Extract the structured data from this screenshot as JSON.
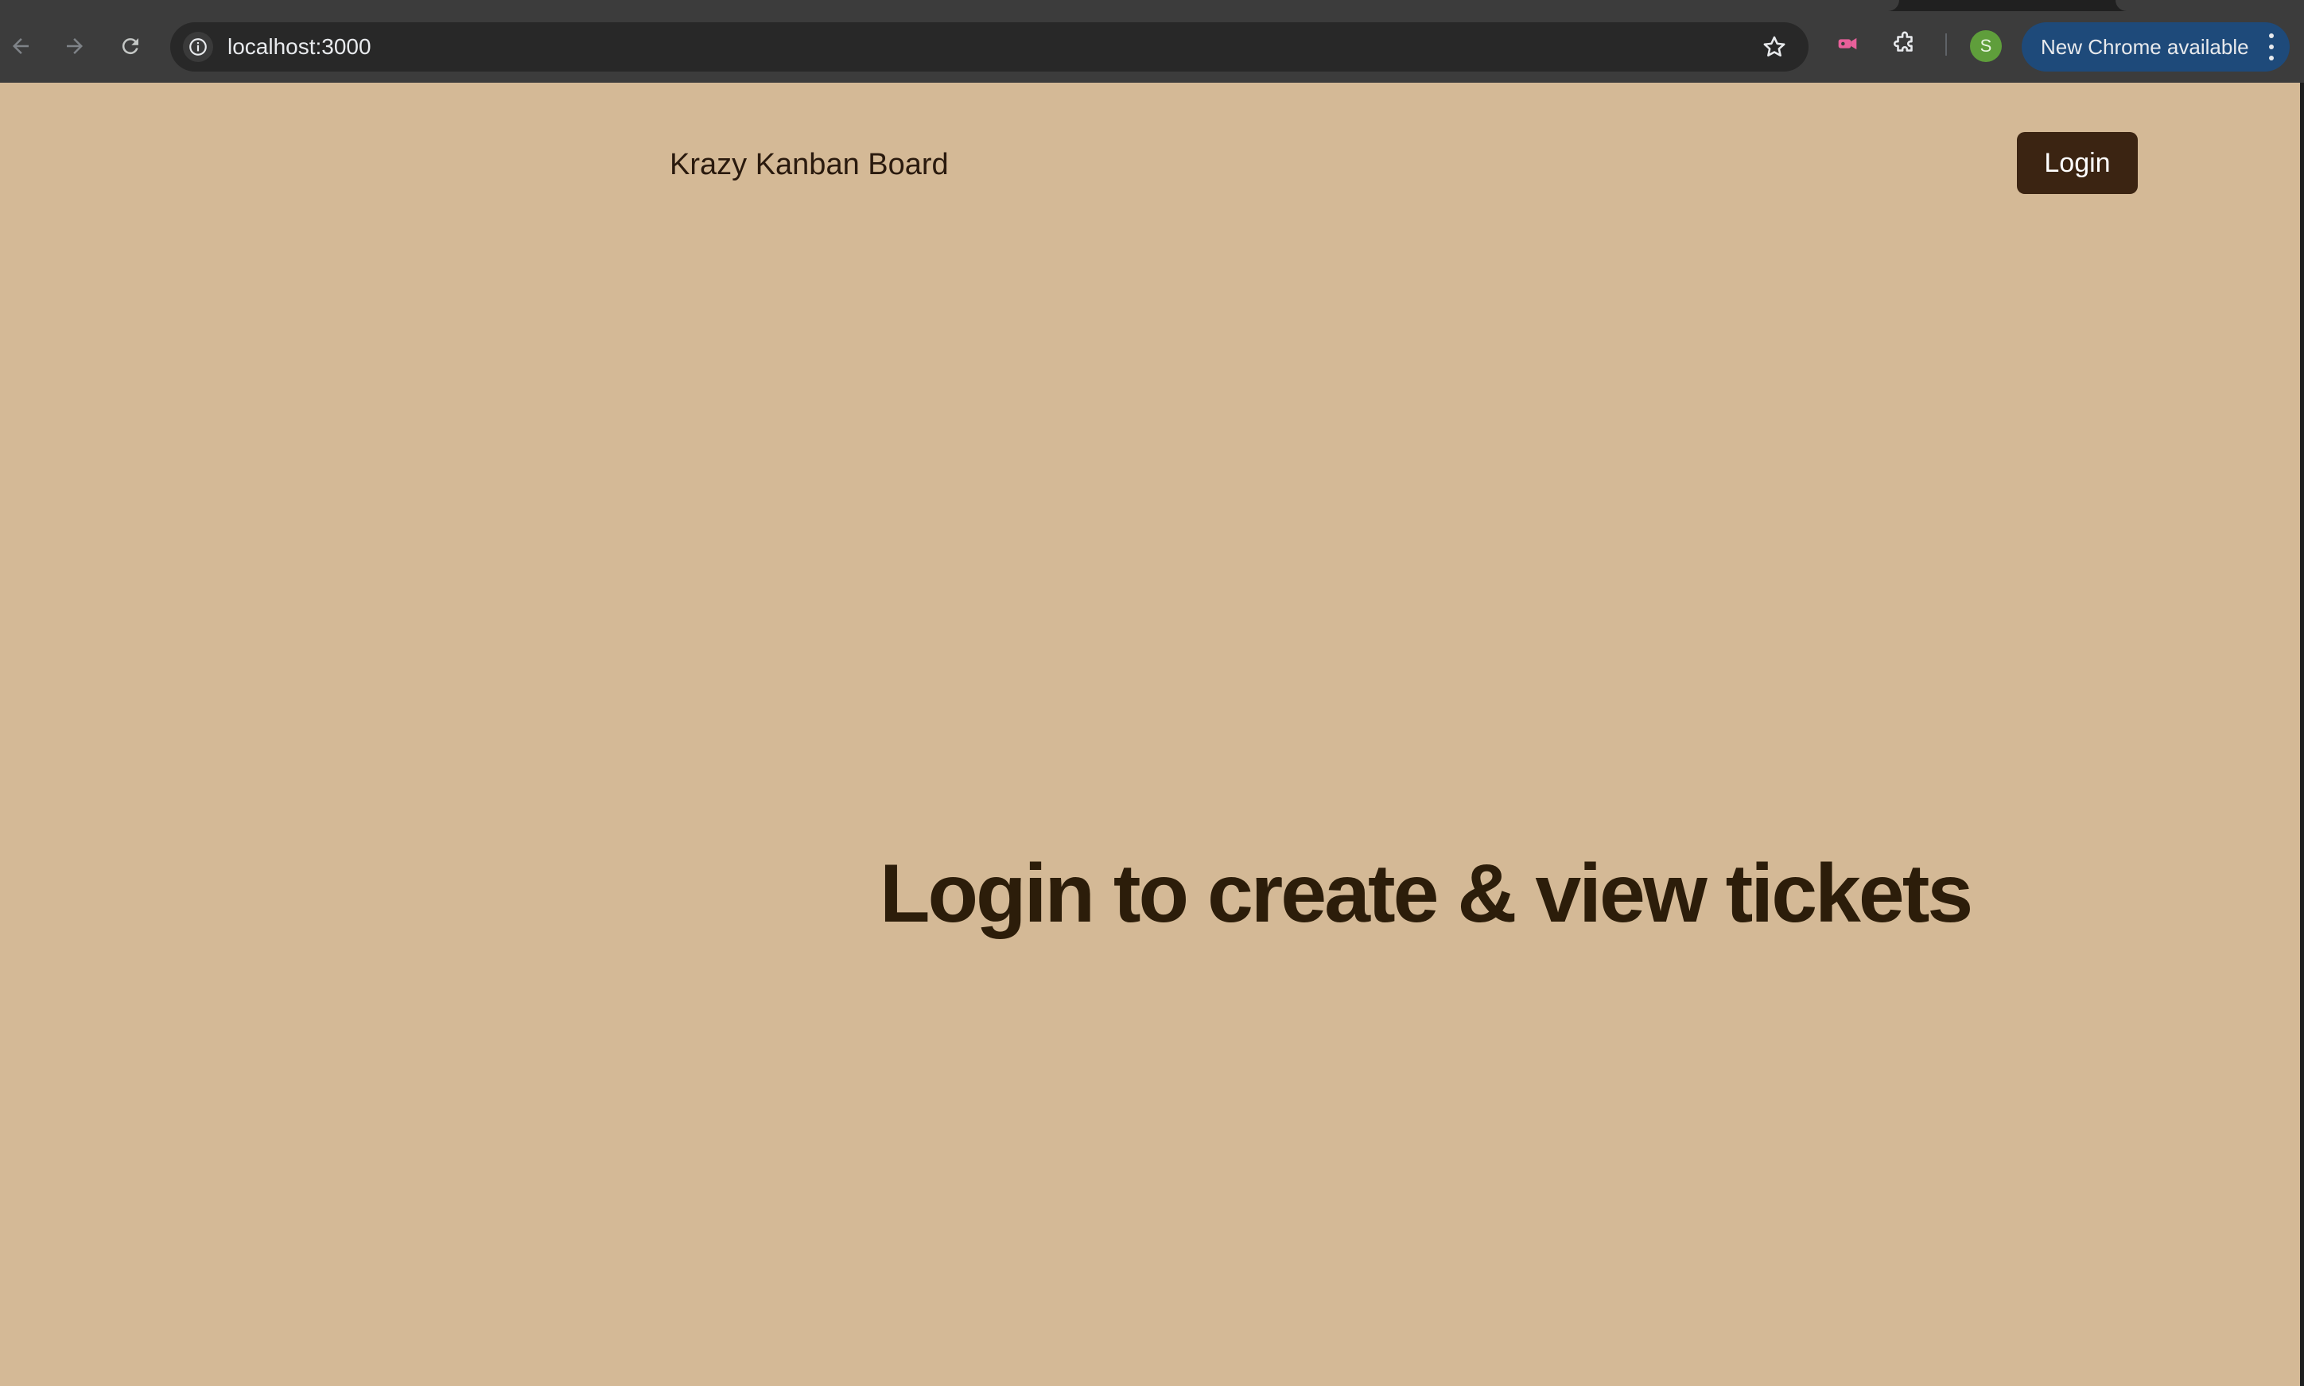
{
  "browser": {
    "url": "localhost:3000",
    "profile_initial": "S",
    "update_label": "New Chrome available",
    "icons": {
      "back": "back-arrow-icon",
      "forward": "forward-arrow-icon",
      "reload": "reload-icon",
      "site_info": "info-icon",
      "bookmark": "star-icon",
      "extension_recorder": "recorder-extension-icon",
      "extensions": "puzzle-icon",
      "menu": "kebab-menu-icon"
    }
  },
  "app": {
    "brand": "Krazy Kanban Board",
    "login_label": "Login",
    "headline": "Login to create & view tickets"
  },
  "colors": {
    "page_background": "#d4b996",
    "login_button": "#3b2412",
    "headline_text": "#2c1d0a",
    "update_pill": "#1e4a7a"
  }
}
